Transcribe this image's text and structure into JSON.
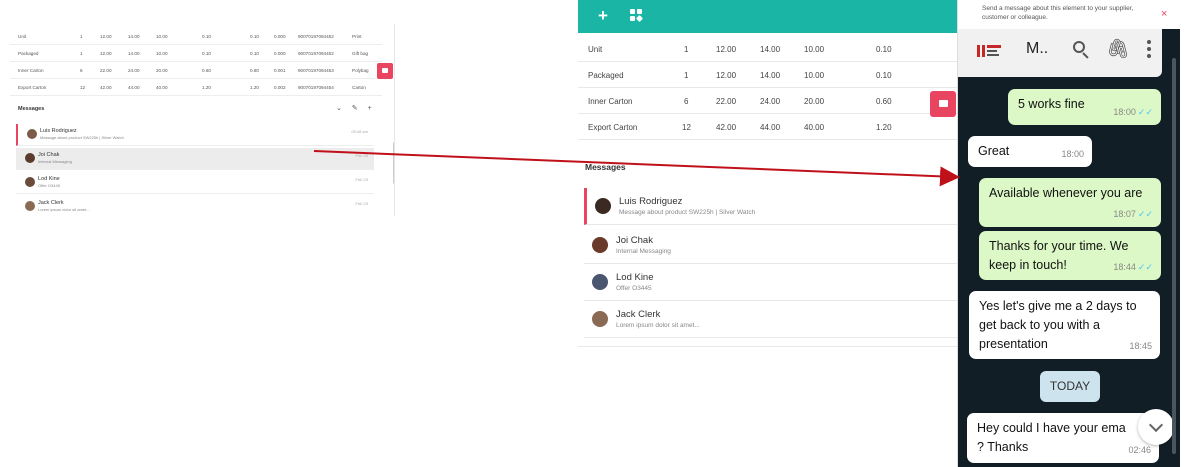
{
  "small_view": {
    "rows": [
      {
        "label": "Unit",
        "qty": "1",
        "c1": "12.00",
        "c2": "14.00",
        "c3": "10.00",
        "c4": "0.10",
        "c5": "0.10",
        "c6": "0.000",
        "code": "90070197094452",
        "pack": "Print"
      },
      {
        "label": "Packaged",
        "qty": "1",
        "c1": "12.00",
        "c2": "14.00",
        "c3": "10.00",
        "c4": "0.10",
        "c5": "0.10",
        "c6": "0.000",
        "code": "90070197094452",
        "pack": "Gift bag"
      },
      {
        "label": "Inner Carton",
        "qty": "6",
        "c1": "22.00",
        "c2": "24.00",
        "c3": "20.00",
        "c4": "0.60",
        "c5": "0.80",
        "c6": "0.001",
        "code": "90070197094453",
        "pack": "Polybag"
      },
      {
        "label": "Export Carton",
        "qty": "12",
        "c1": "42.00",
        "c2": "44.00",
        "c3": "40.00",
        "c4": "1.20",
        "c5": "1.20",
        "c6": "0.002",
        "code": "90070197094454",
        "pack": "Carton"
      }
    ],
    "messages_title": "Messages",
    "tools": "⌄ ✎ +",
    "items": [
      {
        "name": "Luis Rodriguez",
        "sub": "Message about product SW225h | Silver Watch",
        "date": "09:48 am"
      },
      {
        "name": "Joi Chak",
        "sub": "Internal Messaging",
        "date": "Feb 23"
      },
      {
        "name": "Lod Kine",
        "sub": "Offer O3445",
        "date": "Feb 23"
      },
      {
        "name": "Jack Clerk",
        "sub": "Lorem ipsum dolor sit amet...",
        "date": "Feb 23"
      }
    ]
  },
  "big_view": {
    "topbar": {
      "plus": "+"
    },
    "rows": [
      {
        "label": "Unit",
        "qty": "1",
        "c1": "12.00",
        "c2": "14.00",
        "c3": "10.00",
        "c4": "0.10"
      },
      {
        "label": "Packaged",
        "qty": "1",
        "c1": "12.00",
        "c2": "14.00",
        "c3": "10.00",
        "c4": "0.10"
      },
      {
        "label": "Inner Carton",
        "qty": "6",
        "c1": "22.00",
        "c2": "24.00",
        "c3": "20.00",
        "c4": "0.60"
      },
      {
        "label": "Export Carton",
        "qty": "12",
        "c1": "42.00",
        "c2": "44.00",
        "c3": "40.00",
        "c4": "1.20"
      }
    ],
    "messages_title": "Messages",
    "items": [
      {
        "name": "Luis Rodriguez",
        "sub": "Message about product SW225h | Silver Watch"
      },
      {
        "name": "Joi Chak",
        "sub": "Internal Messaging"
      },
      {
        "name": "Lod Kine",
        "sub": "Offer O3445"
      },
      {
        "name": "Jack Clerk",
        "sub": "Lorem ipsum dolor sit amet..."
      }
    ]
  },
  "chat": {
    "tip": "Send a message about this element to your supplier, customer or colleague.",
    "close": "×",
    "contact_name": "M..",
    "clip": "🖇",
    "today": "TODAY",
    "messages": [
      {
        "text": "5 works fine",
        "time": "18:00",
        "ticks": "✓✓"
      },
      {
        "text": "Great",
        "time": "18:00"
      },
      {
        "text": "Available whenever you are",
        "time": "18:07",
        "ticks": "✓✓"
      },
      {
        "text": "Thanks for your time. We keep in touch!",
        "time": "18:44",
        "ticks": "✓✓"
      },
      {
        "text": "Yes let's give me a 2 days to get back to you with a presentation",
        "time": "18:45"
      },
      {
        "text": "Hey could I have your ema ? Thanks",
        "time": "02:46"
      }
    ]
  },
  "colors": {
    "teal": "#1ab5a5",
    "accent": "#e94560",
    "chat_bg": "#121e26",
    "outgoing": "#dcf8c6",
    "arrow": "#c0111a"
  }
}
